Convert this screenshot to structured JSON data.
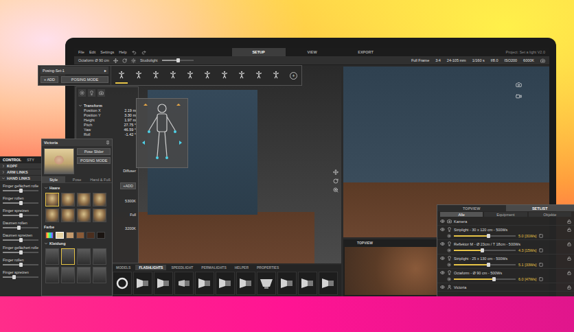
{
  "menu": {
    "items": [
      "File",
      "Edit",
      "Settings",
      "Help"
    ],
    "modes": [
      {
        "label": "SETUP",
        "selected": true
      },
      {
        "label": "VIEW",
        "selected": false
      },
      {
        "label": "EXPORT",
        "selected": false
      }
    ],
    "project": "Project: Set a light V2.0"
  },
  "toolbar": {
    "selection": "Octaform Ø 90 cm",
    "light": {
      "label": "Studiolight",
      "level": 0.5
    },
    "camera": [
      "Full Frame",
      "3:4",
      "24-105 mm",
      "1/160 s",
      "f/8.0",
      "ISO200",
      "6000K"
    ]
  },
  "posing": {
    "title": "Posing-Set-1",
    "arrow": "▸",
    "add": "+ ADD",
    "mode": "POSING MODE",
    "plus": "+",
    "poses": [
      {
        "selected": true
      },
      {
        "selected": false
      },
      {
        "selected": false
      },
      {
        "selected": false
      },
      {
        "selected": false
      },
      {
        "selected": false
      },
      {
        "selected": false
      },
      {
        "selected": false
      },
      {
        "selected": false
      },
      {
        "selected": false
      }
    ]
  },
  "properties": {
    "transform_title": "Transform",
    "transform": [
      {
        "label": "Position X",
        "value": "2.19 m"
      },
      {
        "label": "Position Y",
        "value": "3.30 m"
      },
      {
        "label": "Height",
        "value": "1.97 m"
      },
      {
        "label": "Pitch",
        "value": "27.75 °"
      },
      {
        "label": "Yaw",
        "value": "46.59 °"
      },
      {
        "label": "Roll",
        "value": "-1.42 °"
      }
    ],
    "diffuser": "Diffuser",
    "add": "+ADD",
    "temperature": "5300K",
    "power": "Full",
    "temperature2": "3200K"
  },
  "model": {
    "title": "Victoria",
    "pose_slider": "Pose Slider",
    "mode": "POSING MODE",
    "tabs": [
      {
        "label": "Style",
        "selected": true
      },
      {
        "label": "Pose",
        "selected": false
      },
      {
        "label": "Hand & Fuß",
        "selected": false
      }
    ],
    "hair_title": "Haare",
    "hair": [
      {
        "selected": true
      },
      {
        "selected": false
      },
      {
        "selected": false
      },
      {
        "selected": false
      },
      {
        "selected": false
      },
      {
        "selected": false
      },
      {
        "selected": false
      },
      {
        "selected": false
      }
    ],
    "color_title": "Farbe",
    "colors": [
      {
        "kind": "picker",
        "selected": false
      },
      {
        "kind": "swatch",
        "color": "#e6d3a3",
        "selected": true
      },
      {
        "kind": "swatch",
        "color": "#c49a6c",
        "selected": false
      },
      {
        "kind": "swatch",
        "color": "#8a5a36",
        "selected": false
      },
      {
        "kind": "swatch",
        "color": "#4a2e1e",
        "selected": false
      },
      {
        "kind": "swatch",
        "color": "#1a1411",
        "selected": false
      }
    ],
    "clothing_title": "Kleidung",
    "clothing": [
      {
        "selected": false
      },
      {
        "selected": true
      },
      {
        "selected": false
      },
      {
        "selected": false
      },
      {
        "selected": false
      },
      {
        "selected": false
      },
      {
        "selected": false
      },
      {
        "selected": false
      }
    ]
  },
  "control": {
    "tabs": [
      {
        "label": "CONTROL",
        "selected": true
      },
      {
        "label": "STY",
        "selected": false
      }
    ],
    "groups": [
      {
        "label": "KOPF",
        "expanded": false
      },
      {
        "label": "ARM LINKS",
        "expanded": false
      },
      {
        "label": "HAND LINKS",
        "expanded": true
      }
    ],
    "sliders": [
      {
        "label": "Finger gefächert rolle",
        "level": 0.5
      },
      {
        "label": "Finger rollen",
        "level": 0.5
      },
      {
        "label": "Finger spreizen",
        "level": 0.5
      },
      {
        "label": "Daumen rollen",
        "level": 0.45
      },
      {
        "label": "Daumen spreizen",
        "level": 0.5
      },
      {
        "label": "Finger gefächert rolle",
        "level": 0.5
      },
      {
        "label": "Finger rollen",
        "level": 0.5
      },
      {
        "label": "Finger spreizen",
        "level": 0.3
      }
    ]
  },
  "library": {
    "tabs": [
      {
        "label": "MODELS",
        "selected": false
      },
      {
        "label": "FLASHLIGHTS",
        "selected": true
      },
      {
        "label": "SPEEDLIGHT",
        "selected": false
      },
      {
        "label": "PERMALIGHTS",
        "selected": false
      },
      {
        "label": "HELPER",
        "selected": false
      },
      {
        "label": "PROPERTIES",
        "selected": false
      }
    ],
    "items": [
      {
        "kind": "ring",
        "selected": false
      },
      {
        "kind": "reflector",
        "selected": false
      },
      {
        "kind": "reflector",
        "selected": false
      },
      {
        "kind": "snoot",
        "selected": false
      },
      {
        "kind": "reflector",
        "selected": false
      },
      {
        "kind": "reflector",
        "selected": false
      },
      {
        "kind": "reflector",
        "selected": false
      },
      {
        "kind": "dish",
        "selected": false
      },
      {
        "kind": "reflector",
        "selected": false
      },
      {
        "kind": "reflector",
        "selected": false
      },
      {
        "kind": "reflector",
        "selected": false
      }
    ]
  },
  "topview": {
    "title": "TOPVIEW"
  },
  "setlist": {
    "tabs": [
      {
        "label": "TOPVIEW",
        "selected": false
      },
      {
        "label": "SETLIST",
        "selected": true
      }
    ],
    "filters": [
      {
        "label": "Alle",
        "selected": true
      },
      {
        "label": "Equipment",
        "selected": false
      },
      {
        "label": "Objekte",
        "selected": false
      }
    ],
    "rows": [
      {
        "kind": "camera",
        "name": "Kamera",
        "visible": true
      },
      {
        "kind": "light",
        "name": "Striplight - 30 x 120 cm - 500Ws",
        "visible": true,
        "level": 0.55,
        "reading": "5.0 [31Ws]"
      },
      {
        "kind": "light",
        "name": "Reflektor M - Ø 23cm / T 18cm - 500Ws",
        "visible": true,
        "level": 0.45,
        "reading": "4.3 [15Ws]"
      },
      {
        "kind": "light",
        "name": "Striplight - 25 x 130 cm - 500Ws",
        "visible": true,
        "level": 0.56,
        "reading": "5.1 [33Ws]"
      },
      {
        "kind": "light",
        "name": "Octaform - Ø 90 cm - 500Ws",
        "visible": true,
        "level": 0.65,
        "reading": "6.0 [47Ws]"
      },
      {
        "kind": "model",
        "name": "Victoria",
        "visible": true
      }
    ]
  }
}
